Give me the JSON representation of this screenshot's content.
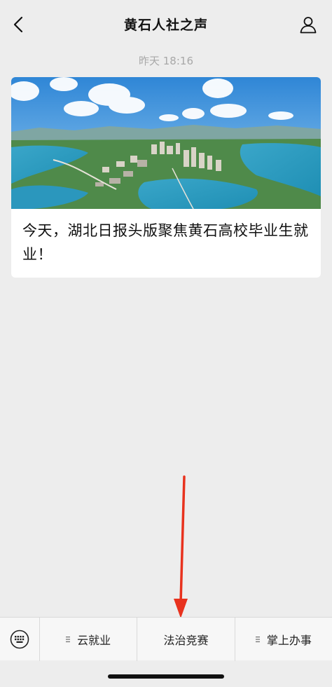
{
  "header": {
    "title": "黄石人社之声",
    "back_icon": "chevron-left-icon",
    "profile_icon": "person-icon"
  },
  "chat": {
    "timestamp": "昨天 18:16",
    "article": {
      "title": "今天，湖北日报头版聚焦黄石高校毕业生就业！",
      "image": "aerial-lake-city-photo"
    }
  },
  "annotation": {
    "arrow_color": "#e8321e"
  },
  "menu_bar": {
    "keyboard_icon": "keyboard-icon",
    "items": [
      {
        "label": "云就业",
        "has_submenu": true
      },
      {
        "label": "法治竞赛",
        "has_submenu": false
      },
      {
        "label": "掌上办事",
        "has_submenu": true
      }
    ]
  }
}
